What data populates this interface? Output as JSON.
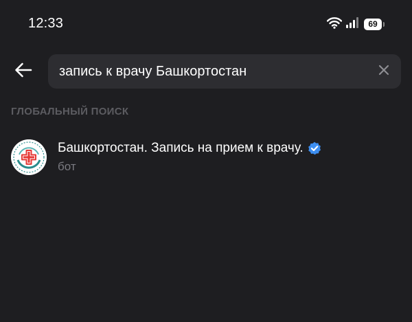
{
  "status_bar": {
    "time": "12:33",
    "battery_level": "69",
    "icons": [
      "wifi-icon",
      "signal-icon",
      "battery-icon"
    ]
  },
  "header": {
    "back_icon": "arrow-left-icon",
    "search": {
      "value": "запись к врачу Башкортостан",
      "clear_icon": "close-icon"
    }
  },
  "section": {
    "title": "ГЛОБАЛЬНЫЙ ПОИСК"
  },
  "results": [
    {
      "title": "Башкортостан. Запись на прием к врачу.",
      "subtitle": "бот",
      "verified": true,
      "avatar_icon": "medical-cross-logo"
    }
  ],
  "colors": {
    "background": "#1e1e21",
    "search_bg": "#2d2d31",
    "section_text": "#5c5c61",
    "subtitle_text": "#7a7a80",
    "verified_blue": "#3d8ef0",
    "logo_red": "#e53935",
    "logo_teal": "#2a8c8c"
  }
}
